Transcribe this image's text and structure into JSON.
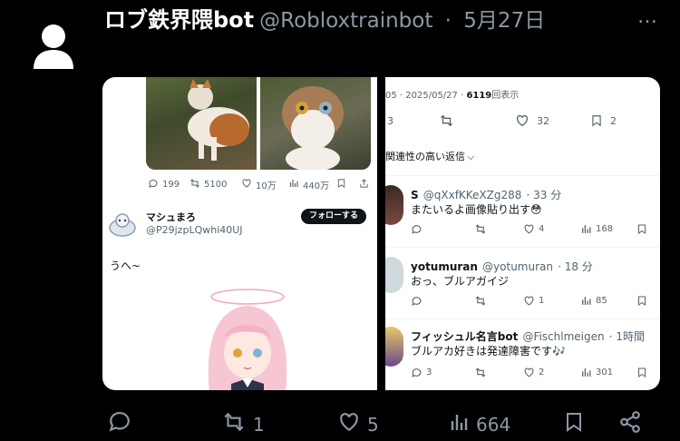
{
  "tweet": {
    "display_name": "ロブ鉄界隈bot",
    "handle": "@Robloxtrainbot",
    "date": "5月27日",
    "more": "…"
  },
  "left_panel": {
    "stats": {
      "replies": "199",
      "retweets": "5100",
      "likes": "10万",
      "views": "440万"
    },
    "user": {
      "name": "マシュまろ",
      "handle": "@P29jzpLQwhi40UJ",
      "follow": "フォローする"
    },
    "text": "うへ~"
  },
  "right_panel": {
    "meta_prefix": "05 · 2025/05/27 · ",
    "views_count": "6119",
    "views_label": "回表示",
    "stats": {
      "replies": "3",
      "likes": "32",
      "bookmarks": "2"
    },
    "sort_label": "関連性の高い返信",
    "replies": [
      {
        "name": "S",
        "handle": "@qXxfKKeXZg288",
        "time": "· 33 分",
        "text": "またいるよ画像貼り出す😳",
        "replies": "",
        "likes": "4",
        "views": "168"
      },
      {
        "name": "yotumuran",
        "handle": "@yotumuran",
        "time": "· 18 分",
        "text": "おっ、ブルアガイジ",
        "replies": "",
        "likes": "1",
        "views": "85"
      },
      {
        "name": "フィッシュル名言bot",
        "handle": "@Fischlmeigen",
        "time": "· 1時間",
        "text": "ブルアカ好きは発達障害です🎶",
        "replies": "3",
        "likes": "2",
        "views": "301"
      }
    ]
  },
  "action_bar": {
    "retweets": "1",
    "likes": "5",
    "views": "664"
  },
  "colors": {
    "background": "#000000",
    "text": "#e7e9ea",
    "muted": "#8b98a5",
    "panel": "#ffffff"
  }
}
